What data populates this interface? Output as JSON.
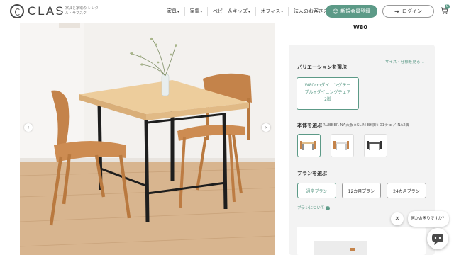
{
  "header": {
    "logo_text": "CLAS",
    "logo_tagline": "家具と家電の レンタル・サブスク",
    "nav": [
      {
        "label": "家具",
        "has_dropdown": true
      },
      {
        "label": "家電",
        "has_dropdown": true
      },
      {
        "label": "ベビー＆キッズ",
        "has_dropdown": true
      },
      {
        "label": "オフィス",
        "has_dropdown": true
      },
      {
        "label": "法人のお客さまへ",
        "has_dropdown": false
      }
    ],
    "register_label": "新規会員登録",
    "login_label": "ログイン",
    "cart_count": "0"
  },
  "gallery": {
    "prev_icon": "chevron-left-icon",
    "next_icon": "chevron-right-icon"
  },
  "product": {
    "title_fragment": "W80"
  },
  "variation": {
    "label": "バリエーションを選ぶ",
    "size_link": "サイズ・仕様を見る",
    "option_lines": [
      "W80cmダイニングテー",
      "ブル+ダイニングチェア",
      "2脚"
    ]
  },
  "body": {
    "label": "本体を選ぶ",
    "value": "RUBBER NA天板×SLIM BK脚+01チェア NA2脚"
  },
  "plan": {
    "label": "プランを選ぶ",
    "options": [
      {
        "label": "通常プラン",
        "selected": true
      },
      {
        "label": "12カ月プラン",
        "selected": false
      },
      {
        "label": "24カ月プラン",
        "selected": false
      }
    ],
    "about_link": "プランについて"
  },
  "chat": {
    "bubble": "何かお困りですか？",
    "close_symbol": "✕"
  },
  "colors": {
    "accent": "#5c9a87",
    "panel_bg": "#f3f3f3"
  }
}
